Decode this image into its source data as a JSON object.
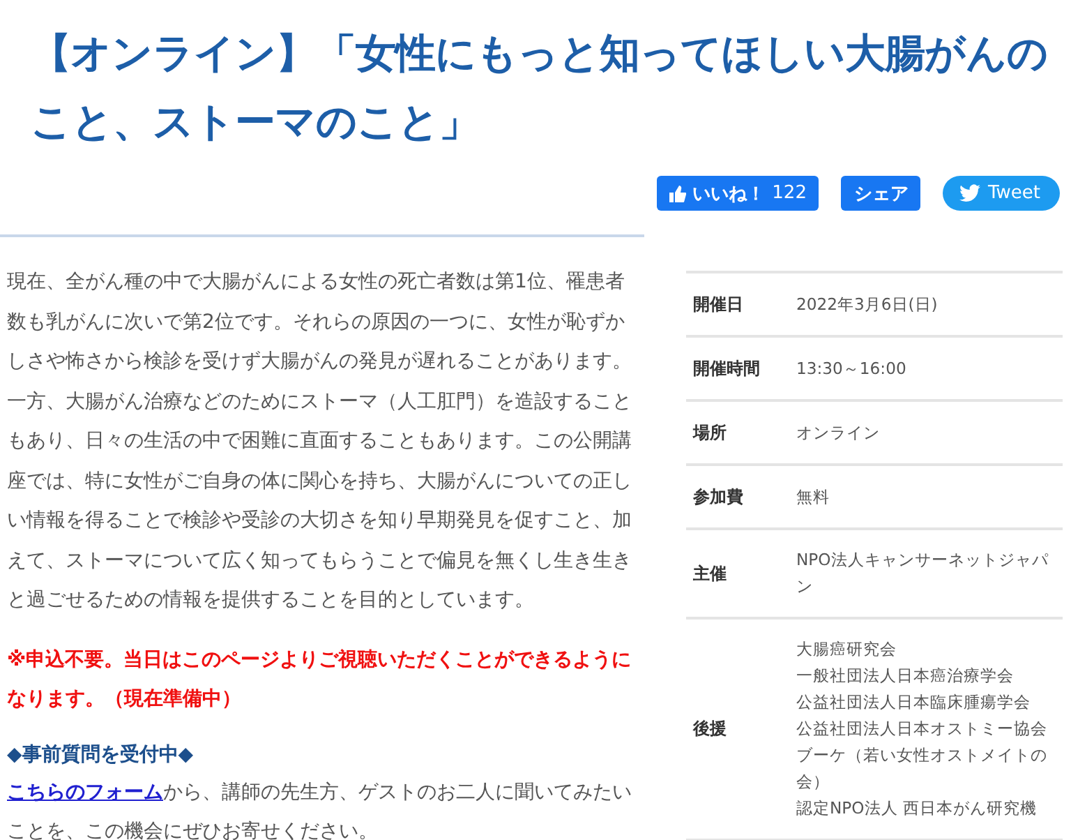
{
  "title": "【オンライン】「女性にもっと知ってほしい大腸がんのこと、ストーマのこと」",
  "social": [
    {
      "kind": "like",
      "label": "いいね！",
      "count": "122"
    },
    {
      "kind": "share",
      "label": "シェア"
    },
    {
      "kind": "tweet",
      "label": "Tweet"
    }
  ],
  "description": "現在、全がん種の中で大腸がんによる女性の死亡者数は第1位、罹患者数も乳がんに次いで第2位です。それらの原因の一つに、女性が恥ずかしさや怖さから検診を受けず大腸がんの発見が遅れることがあります。一方、大腸がん治療などのためにストーマ（人工肛門）を造設することもあり、日々の生活の中で困難に直面することもあります。この公開講座では、特に女性がご自身の体に関心を持ち、大腸がんについての正しい情報を得ることで検診や受診の大切さを知り早期発見を促すこと、加えて、ストーマについて広く知ってもらうことで偏見を無くし生き生きと過ごせるための情報を提供することを目的としています。",
  "notice": "※申込不要。当日はこのページよりご視聴いただくことができるようになります。（現在準備中）",
  "questions": {
    "heading": "◆事前質問を受付中◆",
    "link": "こちらのフォーム",
    "text": "から、講師の先生方、ゲストのお二人に聞いてみたいことを、この機会にぜひお寄せください。"
  },
  "details": [
    {
      "label": "開催日",
      "values": [
        "2022年3月6日(日)"
      ]
    },
    {
      "label": "開催時間",
      "values": [
        "13:30～16:00"
      ]
    },
    {
      "label": "場所",
      "values": [
        "オンライン"
      ]
    },
    {
      "label": "参加費",
      "values": [
        "無料"
      ]
    },
    {
      "label": "主催",
      "values": [
        "NPO法人キャンサーネットジャパン"
      ]
    },
    {
      "label": "後援",
      "values": [
        "大腸癌研究会",
        "一般社団法人日本癌治療学会",
        "公益社団法人日本臨床腫瘍学会",
        "公益社団法人日本オストミー協会",
        "ブーケ（若い女性オストメイトの会）",
        "認定NPO法人 西日本がん研究機"
      ]
    }
  ]
}
